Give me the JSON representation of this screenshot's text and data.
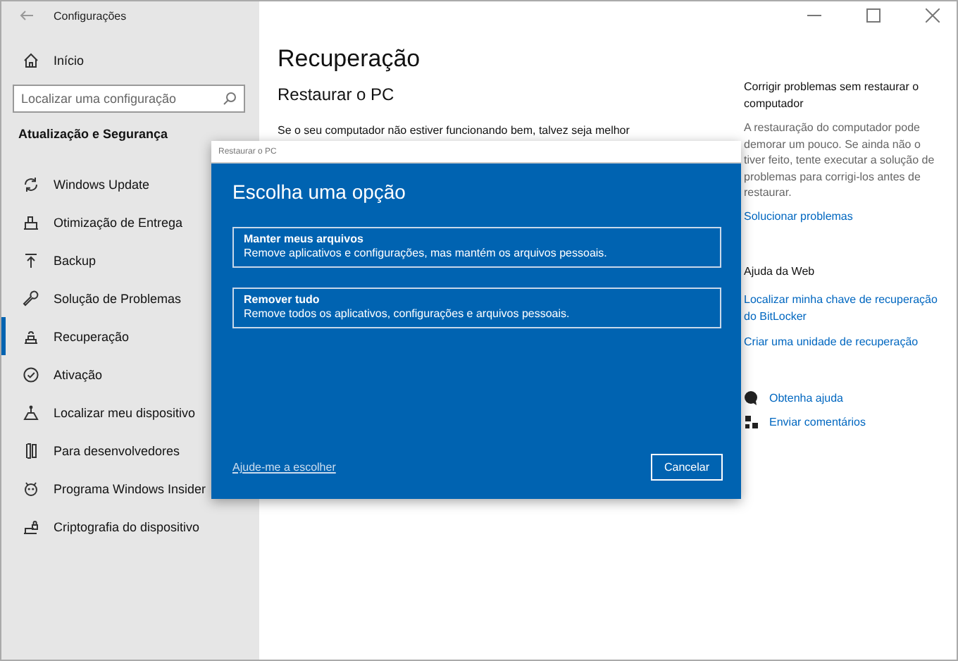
{
  "window": {
    "title": "Configurações"
  },
  "sidebar": {
    "home": "Início",
    "search": {
      "placeholder": "Localizar uma configuração"
    },
    "section_title": "Atualização e Segurança",
    "items": [
      {
        "label": "Windows Update",
        "selected": false
      },
      {
        "label": "Otimização de Entrega",
        "selected": false
      },
      {
        "label": "Backup",
        "selected": false
      },
      {
        "label": "Solução de Problemas",
        "selected": false
      },
      {
        "label": "Recuperação",
        "selected": true
      },
      {
        "label": "Ativação",
        "selected": false
      },
      {
        "label": "Localizar meu dispositivo",
        "selected": false
      },
      {
        "label": "Para desenvolvedores",
        "selected": false
      },
      {
        "label": "Programa Windows Insider",
        "selected": false
      },
      {
        "label": "Criptografia do dispositivo",
        "selected": false
      }
    ]
  },
  "main": {
    "title": "Recuperação",
    "section": "Restaurar o PC",
    "text": "Se o seu computador não estiver funcionando bem, talvez seja melhor"
  },
  "help_panel": {
    "title": "Corrigir problemas sem restaurar o computador",
    "text": "A restauração do computador pode demorar um pouco. Se ainda não o tiver feito, tente executar a solução de problemas para corrigi-los antes de restaurar.",
    "link": "Solucionar problemas",
    "web_title": "Ajuda da Web",
    "web_links": [
      "Localizar minha chave de recuperação do BitLocker",
      "Criar uma unidade de recuperação"
    ],
    "actions": [
      {
        "label": "Obtenha ajuda"
      },
      {
        "label": "Enviar comentários"
      }
    ]
  },
  "dialog": {
    "title": "Restaurar o PC",
    "heading": "Escolha uma opção",
    "options": [
      {
        "title": "Manter meus arquivos",
        "description": "Remove aplicativos e configurações, mas mantém os arquivos pessoais."
      },
      {
        "title": "Remover tudo",
        "description": "Remove todos os aplicativos, configurações e arquivos pessoais."
      }
    ],
    "help_link": "Ajude-me a escolher",
    "cancel": "Cancelar"
  }
}
